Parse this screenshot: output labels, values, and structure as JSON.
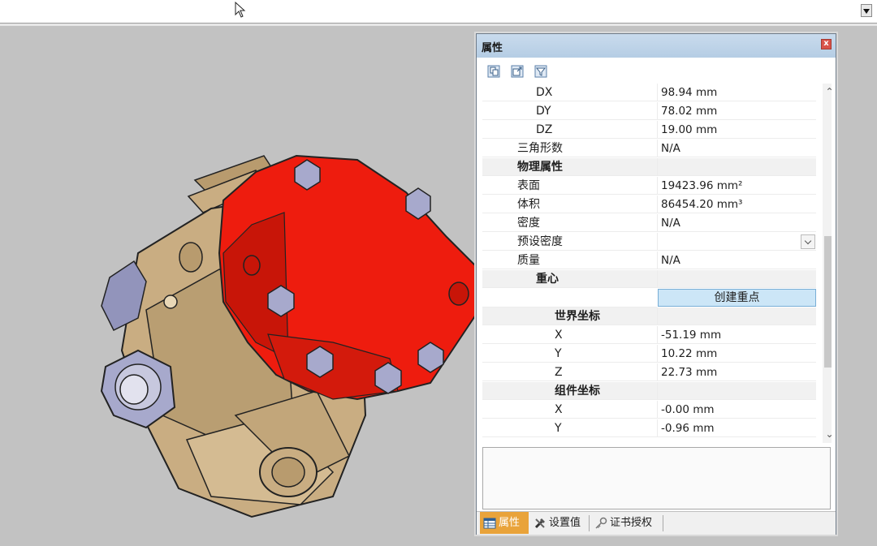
{
  "toolbar_top": {
    "dropdown": "expand"
  },
  "panel": {
    "title": "属性",
    "close": "x",
    "toolbar_icons": [
      "copy-icon",
      "export-icon",
      "filter-icon"
    ]
  },
  "properties": {
    "dx": {
      "label": "DX",
      "value": "98.94 mm"
    },
    "dy": {
      "label": "DY",
      "value": "78.02 mm"
    },
    "dz": {
      "label": "DZ",
      "value": "19.00 mm"
    },
    "triangles": {
      "label": "三角形数",
      "value": "N/A"
    },
    "physical": {
      "label": "物理属性",
      "surface": {
        "label": "表面",
        "value": "19423.96 mm²"
      },
      "volume": {
        "label": "体积",
        "value": "86454.20 mm³"
      },
      "density": {
        "label": "密度",
        "value": "N/A"
      },
      "preset_density": {
        "label": "预设密度",
        "value": ""
      },
      "mass": {
        "label": "质量",
        "value": "N/A"
      }
    },
    "center": {
      "label": "重心",
      "create_button": "创建重点",
      "world": {
        "label": "世界坐标",
        "x": {
          "label": "X",
          "value": "-51.19 mm"
        },
        "y": {
          "label": "Y",
          "value": "10.22 mm"
        },
        "z": {
          "label": "Z",
          "value": "22.73 mm"
        }
      },
      "component": {
        "label": "组件坐标",
        "x": {
          "label": "X",
          "value": "-0.00 mm"
        },
        "y": {
          "label": "Y",
          "value": "-0.96 mm"
        }
      }
    }
  },
  "tabs": [
    {
      "label": "属性",
      "icon": "table-icon",
      "active": true
    },
    {
      "label": "设置值",
      "icon": "tools-icon",
      "active": false
    },
    {
      "label": "证书授权",
      "icon": "key-icon",
      "active": false
    }
  ],
  "colors": {
    "highlight_part": "#ee1c0e",
    "body_part": "#c9ad82",
    "bolt": "#a7a9cc",
    "title_bar": "#c4d8ec",
    "active_tab": "#e9a33a",
    "button": "#cce6f7"
  }
}
